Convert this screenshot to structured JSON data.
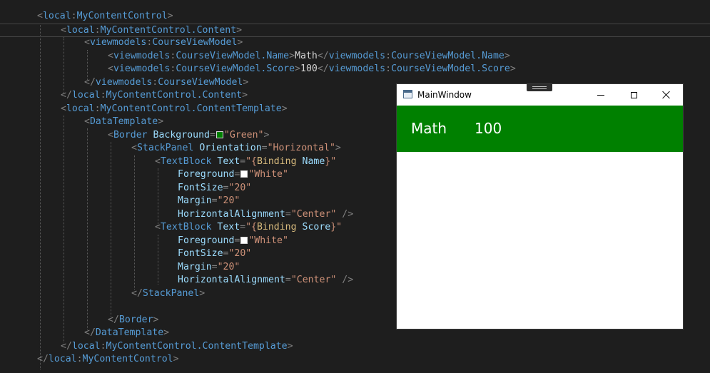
{
  "code": {
    "l1": {
      "prefix": "local",
      "name": "MyContentControl"
    },
    "l2": {
      "prefix": "local",
      "name": "MyContentControl.Content"
    },
    "l3": {
      "prefix": "viewmodels",
      "name": "CourseViewModel"
    },
    "l4": {
      "prefix": "viewmodels",
      "name": "CourseViewModel.Name",
      "text": "Math"
    },
    "l5": {
      "prefix": "viewmodels",
      "name": "CourseViewModel.Score",
      "text": "100"
    },
    "l6": {
      "prefix": "viewmodels",
      "name": "CourseViewModel"
    },
    "l7": {
      "prefix": "local",
      "name": "MyContentControl.Content"
    },
    "l8": {
      "prefix": "local",
      "name": "MyContentControl.ContentTemplate"
    },
    "l9": {
      "name": "DataTemplate"
    },
    "l10": {
      "name": "Border",
      "attr": "Background",
      "value": "\"Green\""
    },
    "l11": {
      "name": "StackPanel",
      "attr": "Orientation",
      "value": "\"Horizontal\""
    },
    "l12": {
      "name": "TextBlock",
      "attr": "Text",
      "open": "\"{",
      "kw": "Binding",
      "arg": " Name",
      "close": "}\""
    },
    "l13": {
      "attr": "Foreground",
      "value": "\"White\""
    },
    "l14": {
      "attr": "FontSize",
      "value": "\"20\""
    },
    "l15": {
      "attr": "Margin",
      "value": "\"20\""
    },
    "l16": {
      "attr": "HorizontalAlignment",
      "value": "\"Center\""
    },
    "l17": {
      "name": "TextBlock",
      "attr": "Text",
      "open": "\"{",
      "kw": "Binding",
      "arg": " Score",
      "close": "}\""
    },
    "l18": {
      "attr": "Foreground",
      "value": "\"White\""
    },
    "l19": {
      "attr": "FontSize",
      "value": "\"20\""
    },
    "l20": {
      "attr": "Margin",
      "value": "\"20\""
    },
    "l21": {
      "attr": "HorizontalAlignment",
      "value": "\"Center\""
    },
    "l22": {
      "name": "StackPanel"
    },
    "l24": {
      "name": "Border"
    },
    "l25": {
      "name": "DataTemplate"
    },
    "l26": {
      "prefix": "local",
      "name": "MyContentControl.ContentTemplate"
    },
    "l27": {
      "prefix": "local",
      "name": "MyContentControl"
    }
  },
  "colors": {
    "green_swatch": "#008000",
    "white_swatch": "#ffffff",
    "window_content": "#008000"
  },
  "window": {
    "title": "MainWindow",
    "icon": "app-window-icon",
    "minimize": "minimize-icon",
    "maximize": "maximize-icon",
    "close": "close-icon",
    "name_value": "Math",
    "score_value": "100"
  }
}
